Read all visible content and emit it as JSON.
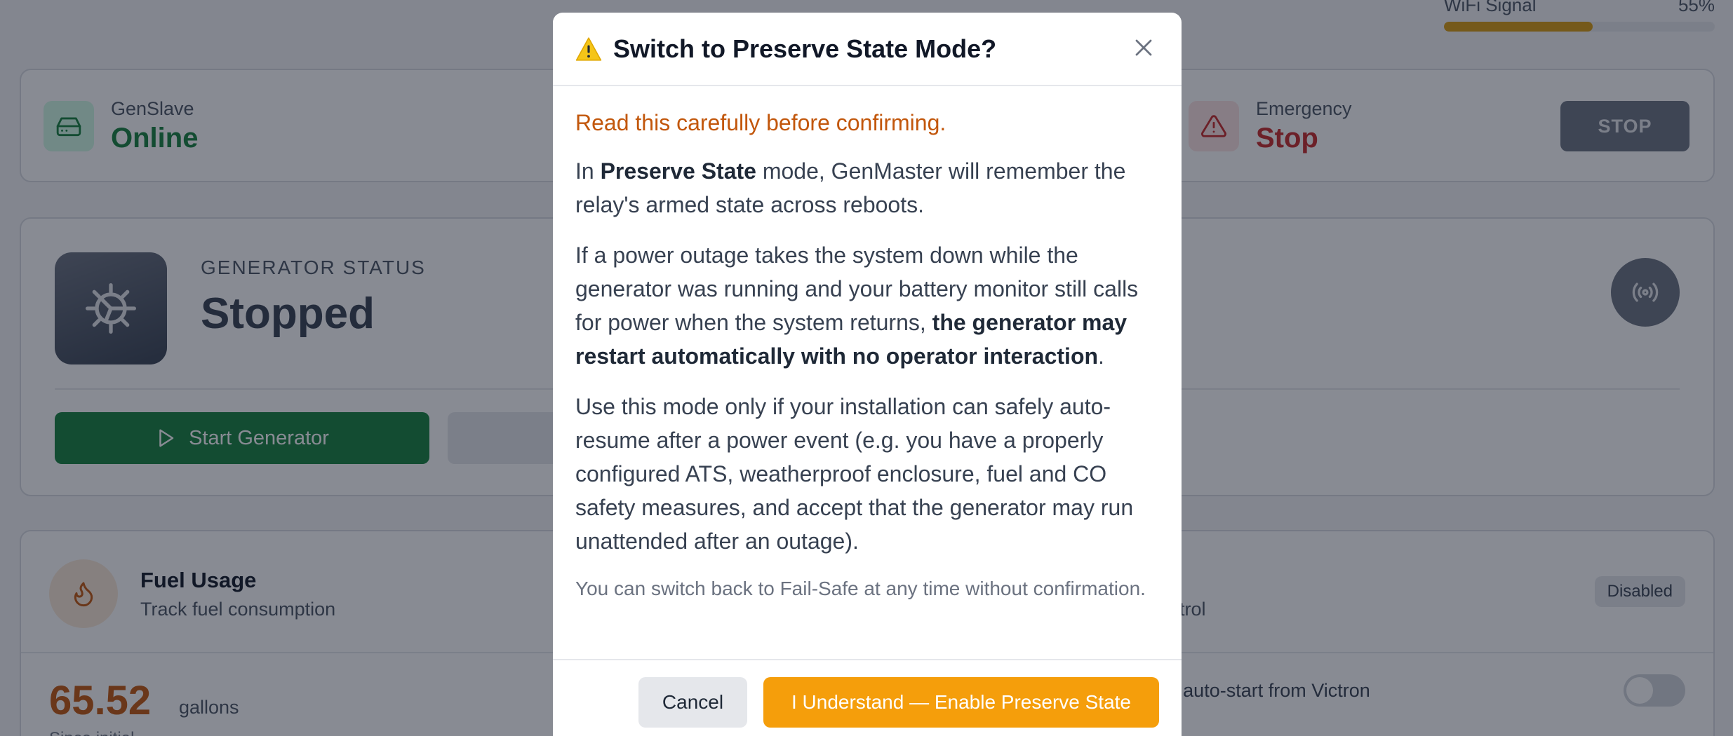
{
  "wifi": {
    "label": "WiFi Signal",
    "value": "55%",
    "level": 0.55
  },
  "connection": {
    "slave": {
      "label": "GenSlave",
      "status": "Online"
    },
    "emergency": {
      "label": "Emergency",
      "status": "Stop",
      "button": "STOP"
    }
  },
  "generator": {
    "label": "GENERATOR STATUS",
    "status": "Stopped",
    "start_button": "Start Generator"
  },
  "fuel": {
    "title": "Fuel Usage",
    "subtitle": "Track fuel consumption",
    "value": "65.52",
    "unit": "gallons",
    "since": "Since initial"
  },
  "control": {
    "subtitle_fragment": "ntrol",
    "badge": "Disabled",
    "victron_text": "'t auto-start from Victron"
  },
  "modal": {
    "title": "Switch to Preserve State Mode?",
    "warning": "Read this carefully before confirming.",
    "p1": {
      "a": "In ",
      "b": "Preserve State",
      "c": " mode, GenMaster will remember the relay's armed state across reboots."
    },
    "p2": {
      "a": "If a power outage takes the system down while the generator was running and your battery monitor still calls for power when the system returns, ",
      "b": "the generator may restart automatically with no operator interaction",
      "c": "."
    },
    "p3": "Use this mode only if your installation can safely auto-resume after a power event (e.g. you have a properly configured ATS, weatherproof enclosure, fuel and CO safety measures, and accept that the generator may run unattended after an outage).",
    "note": "You can switch back to Fail-Safe at any time without confirmation.",
    "cancel": "Cancel",
    "confirm": "I Understand — Enable Preserve State"
  },
  "colors": {
    "online": "#15803d",
    "stop": "#c62828",
    "warning": "#c2570c",
    "confirm": "#f59e0b"
  }
}
